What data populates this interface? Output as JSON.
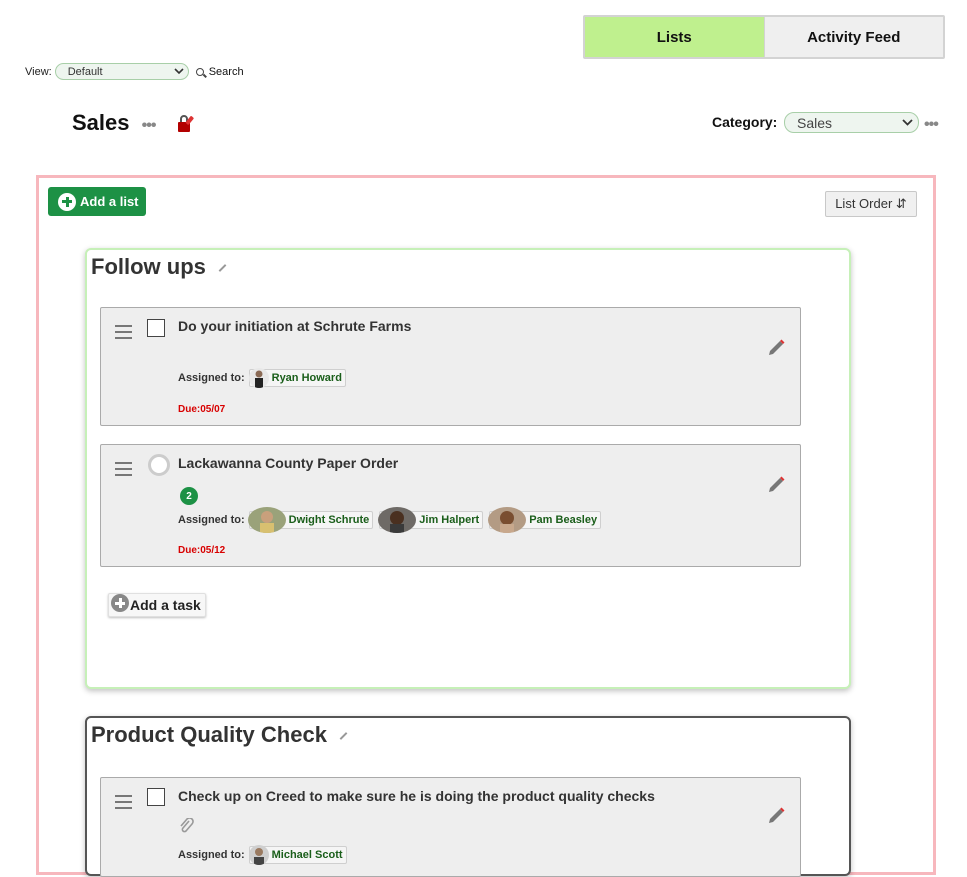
{
  "tabs": [
    {
      "label": "Lists",
      "active": true
    },
    {
      "label": "Activity Feed",
      "active": false
    }
  ],
  "view": {
    "label": "View:",
    "selected": "Default",
    "search_label": "Search"
  },
  "page": {
    "title": "Sales",
    "menu_dots": "•••"
  },
  "category": {
    "label": "Category:",
    "selected": "Sales",
    "menu_dots": "•••"
  },
  "toolbar": {
    "add_list_label": "Add a list",
    "list_order_label": "List Order ⇵"
  },
  "lists": [
    {
      "title": "Follow ups",
      "tasks": [
        {
          "title": "Do your initiation at Schrute Farms",
          "assigned_label": "Assigned to:",
          "assignees": [
            "Ryan Howard"
          ],
          "due": "Due:05/07"
        },
        {
          "title": "Lackawanna County Paper Order",
          "badge": "2",
          "assigned_label": "Assigned to:",
          "assignees": [
            "Dwight Schrute",
            "Jim Halpert",
            "Pam Beasley"
          ],
          "due": "Due:05/12"
        }
      ],
      "add_task_label": "Add a task"
    },
    {
      "title": "Product Quality Check",
      "tasks": [
        {
          "title": "Check up on Creed to make sure he is doing the product quality checks",
          "assigned_label": "Assigned to:",
          "assignees": [
            "Michael Scott"
          ]
        }
      ]
    }
  ],
  "colors": {
    "active_tab": "#bff08e",
    "add_list_green": "#1d9145",
    "container_border": "#f7b7bd",
    "due_red": "#d80000",
    "panel1_border": "#c6f0b8"
  }
}
